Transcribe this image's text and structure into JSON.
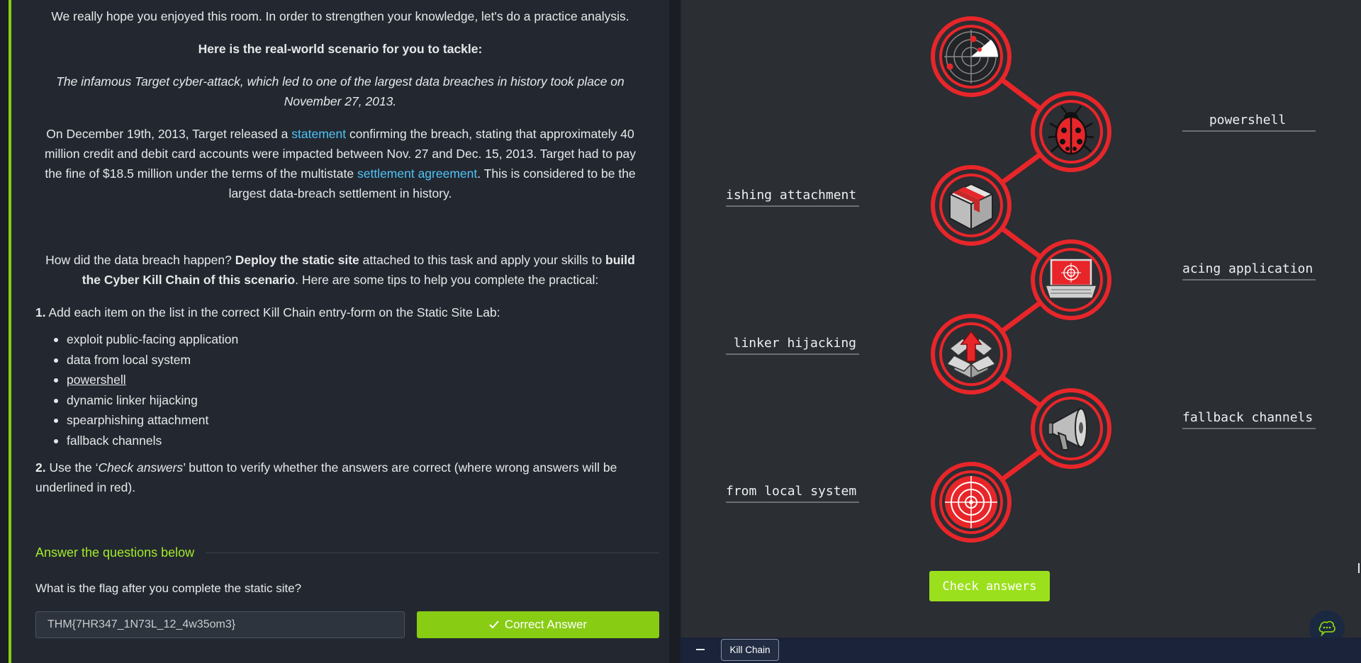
{
  "lesson": {
    "intro": "We really hope you enjoyed this room. In order to strengthen your knowledge, let's do a practice analysis.",
    "scenario_heading": "Here is the real-world scenario for you to tackle:",
    "scenario_italic": "The infamous Target cyber-attack, which led to one of the largest data breaches in history took place on November 27, 2013.",
    "para1_a": "On December 19th, 2013, Target released a ",
    "para1_link1": "statement",
    "para1_b": " confirming the breach, stating that approximately 40 million credit and debit card accounts were impacted between Nov. 27 and Dec. 15, 2013. Target had to pay the fine of $18.5 million under the terms of the multistate ",
    "para1_link2": "settlement agreement",
    "para1_c": ". This is considered to be the largest data-breach settlement in history.",
    "para2_a": "How did the data breach happen? ",
    "para2_b": "Deploy the static site",
    "para2_c": " attached to this task and apply your skills to ",
    "para2_d": "build the Cyber Kill Chain of this scenario",
    "para2_e": ". Here are some tips to help you complete the practical:",
    "tip1_num": "1.",
    "tip1_text": " Add each item on the list in the correct Kill Chain entry-form on the Static Site Lab:",
    "items": [
      "exploit public-facing application",
      "data from local system",
      "powershell",
      "dynamic linker hijacking",
      "spearphishing attachment",
      "fallback channels"
    ],
    "tip2_num": "2.",
    "tip2_a": " Use the ‘",
    "tip2_italic": "Check answers",
    "tip2_b": "’ button to verify whether the answers are correct (where wrong answers will be underlined in red)."
  },
  "questions": {
    "title": "Answer the questions below",
    "question": "What is the flag after you complete the static site?",
    "answer": "THM{7HR347_1N73L_12_4w35om3}",
    "correct_label": "Correct Answer"
  },
  "lab": {
    "slots": {
      "r1": "powershell",
      "l2": "ishing attachment",
      "r3": "acing application",
      "l4": "linker hijacking",
      "r5": "fallback channels",
      "l6": "from local system"
    },
    "check_label": "Check answers",
    "stage_icons": [
      "radar-icon",
      "ladybug-icon",
      "package-icon",
      "laptop-target-icon",
      "open-box-arrow-icon",
      "megaphone-icon",
      "target-icon"
    ],
    "colors": {
      "ring": "#e8262a",
      "accent_green": "#9be01c",
      "brand_green": "#88cc14"
    }
  },
  "taskbar": {
    "tab_label": "Kill Chain"
  }
}
